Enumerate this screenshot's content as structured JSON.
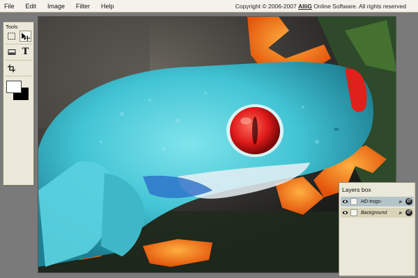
{
  "menubar": {
    "items": [
      "File",
      "Edit",
      "Image",
      "Filter",
      "Help"
    ],
    "copyright_prefix": "Copyright © 2006-2007 ",
    "copyright_brand": "AIliG",
    "copyright_suffix": " Online Software. All rights reserved"
  },
  "tools": {
    "title": "Tools",
    "icons": [
      "rect-select-icon",
      "move-icon",
      "eraser-icon",
      "text-icon",
      "crop-icon"
    ],
    "text_tool_glyph": "T",
    "foreground_color": "#ffffff",
    "background_color": "#000000"
  },
  "canvas": {
    "image_subject": "red-eyed tree frog photo"
  },
  "layers": {
    "title": "Layers box",
    "items": [
      {
        "name": "HD-frogs-",
        "selected": true
      },
      {
        "name": "Background",
        "selected": false
      }
    ],
    "options_glyph": "Ø",
    "expand_glyph": "▶"
  }
}
